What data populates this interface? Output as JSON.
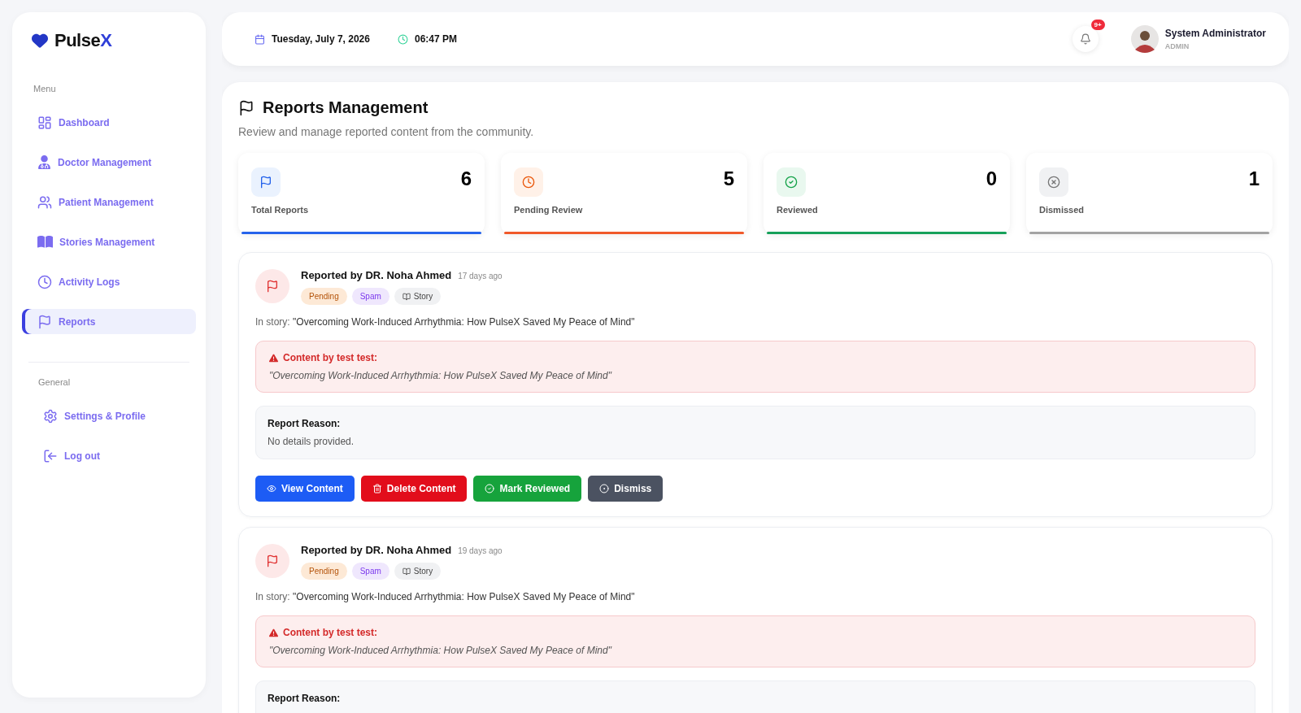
{
  "sidebar": {
    "brand": {
      "name": "Pulse",
      "accent": "X"
    },
    "sections": [
      {
        "title": "Menu",
        "items": [
          {
            "kind": "dashboard",
            "label": "Dashboard",
            "selected": false
          },
          {
            "kind": "doctor",
            "label": "Doctor Management",
            "selected": false
          },
          {
            "kind": "patients",
            "label": "Patient Management",
            "selected": false
          },
          {
            "kind": "stories",
            "label": "Stories Management",
            "selected": false
          },
          {
            "kind": "activity",
            "label": "Activity Logs",
            "selected": false
          },
          {
            "kind": "reports",
            "label": "Reports",
            "selected": true
          }
        ]
      },
      {
        "title": "General",
        "items": [
          {
            "kind": "settings",
            "label": "Settings & Profile",
            "selected": false
          },
          {
            "kind": "logout",
            "label": "Log out",
            "selected": false
          }
        ]
      }
    ]
  },
  "topbar": {
    "date": "Tuesday, July 7, 2026",
    "time": "06:47 PM",
    "notification_badge": "9+",
    "user": {
      "name": "System Administrator",
      "role": "ADMIN"
    }
  },
  "page": {
    "title": "Reports Management",
    "subtitle": "Review and manage reported content from the community."
  },
  "stats": [
    {
      "kind": "total",
      "value": "6",
      "label": "Total Reports",
      "color": "#2563eb"
    },
    {
      "kind": "pending",
      "value": "5",
      "label": "Pending Review",
      "color": "#f0592a"
    },
    {
      "kind": "reviewed",
      "value": "0",
      "label": "Reviewed",
      "color": "#16a05a"
    },
    {
      "kind": "dismissed",
      "value": "1",
      "label": "Dismissed",
      "color": "#a3a3a3"
    }
  ],
  "reports": [
    {
      "reporter": "Reported by DR. Noha Ahmed",
      "age": "17 days ago",
      "tags": [
        {
          "kind": "status",
          "label": "Pending"
        },
        {
          "kind": "category",
          "label": "Spam"
        },
        {
          "kind": "type",
          "label": "Story"
        }
      ],
      "story_prefix": "In story:",
      "story_title": "\"Overcoming Work-Induced Arrhythmia: How PulseX Saved My Peace of Mind\"",
      "content_heading": "Content by test test:",
      "content_quote": "\"Overcoming Work-Induced Arrhythmia: How PulseX Saved My Peace of Mind\"",
      "reason_heading": "Report Reason:",
      "reason_text": "No details provided.",
      "actions": [
        {
          "kind": "view",
          "label": "View Content"
        },
        {
          "kind": "delete",
          "label": "Delete Content"
        },
        {
          "kind": "review",
          "label": "Mark Reviewed"
        },
        {
          "kind": "dismiss",
          "label": "Dismiss"
        }
      ]
    },
    {
      "reporter": "Reported by DR. Noha Ahmed",
      "age": "19 days ago",
      "tags": [
        {
          "kind": "status",
          "label": "Pending"
        },
        {
          "kind": "category",
          "label": "Spam"
        },
        {
          "kind": "type",
          "label": "Story"
        }
      ],
      "story_prefix": "In story:",
      "story_title": "\"Overcoming Work-Induced Arrhythmia: How PulseX Saved My Peace of Mind\"",
      "content_heading": "Content by test test:",
      "content_quote": "\"Overcoming Work-Induced Arrhythmia: How PulseX Saved My Peace of Mind\"",
      "reason_heading": "Report Reason:"
    }
  ]
}
